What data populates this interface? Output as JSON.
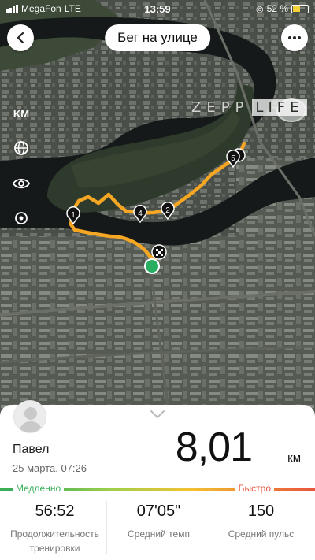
{
  "status_bar": {
    "carrier": "MegaFon",
    "network": "LTE",
    "time": "13:59",
    "battery_percent": "52 %",
    "battery_level": 0.52
  },
  "header": {
    "title": "Бег на улице",
    "back_icon": "chevron-left-icon",
    "more_icon": "more-dots-icon"
  },
  "watermark": {
    "brand": "ZEPP",
    "brand_boxed": "LIFE"
  },
  "map_tools": {
    "units_label": "KM",
    "tools": [
      "globe-icon",
      "eye-icon",
      "locate-icon"
    ]
  },
  "route": {
    "color": "#f5a623",
    "kilometer_markers": [
      "1",
      "2",
      "4",
      "5"
    ],
    "start_color": "#27ae60",
    "finish_icon": "checkered-flag-icon"
  },
  "summary": {
    "name": "Павел",
    "date": "25 марта, 07:26",
    "distance": "8,01",
    "distance_unit": "км",
    "speed_slow": "Медленно",
    "speed_fast": "Быстро",
    "slow_color": "#3cae5a",
    "fast_color": "#e8553e"
  },
  "stats": [
    {
      "value": "56:52",
      "label": "Продолжительность тренировки"
    },
    {
      "value": "07'05\"",
      "label": "Средний темп"
    },
    {
      "value": "150",
      "label": "Средний пульс"
    }
  ]
}
